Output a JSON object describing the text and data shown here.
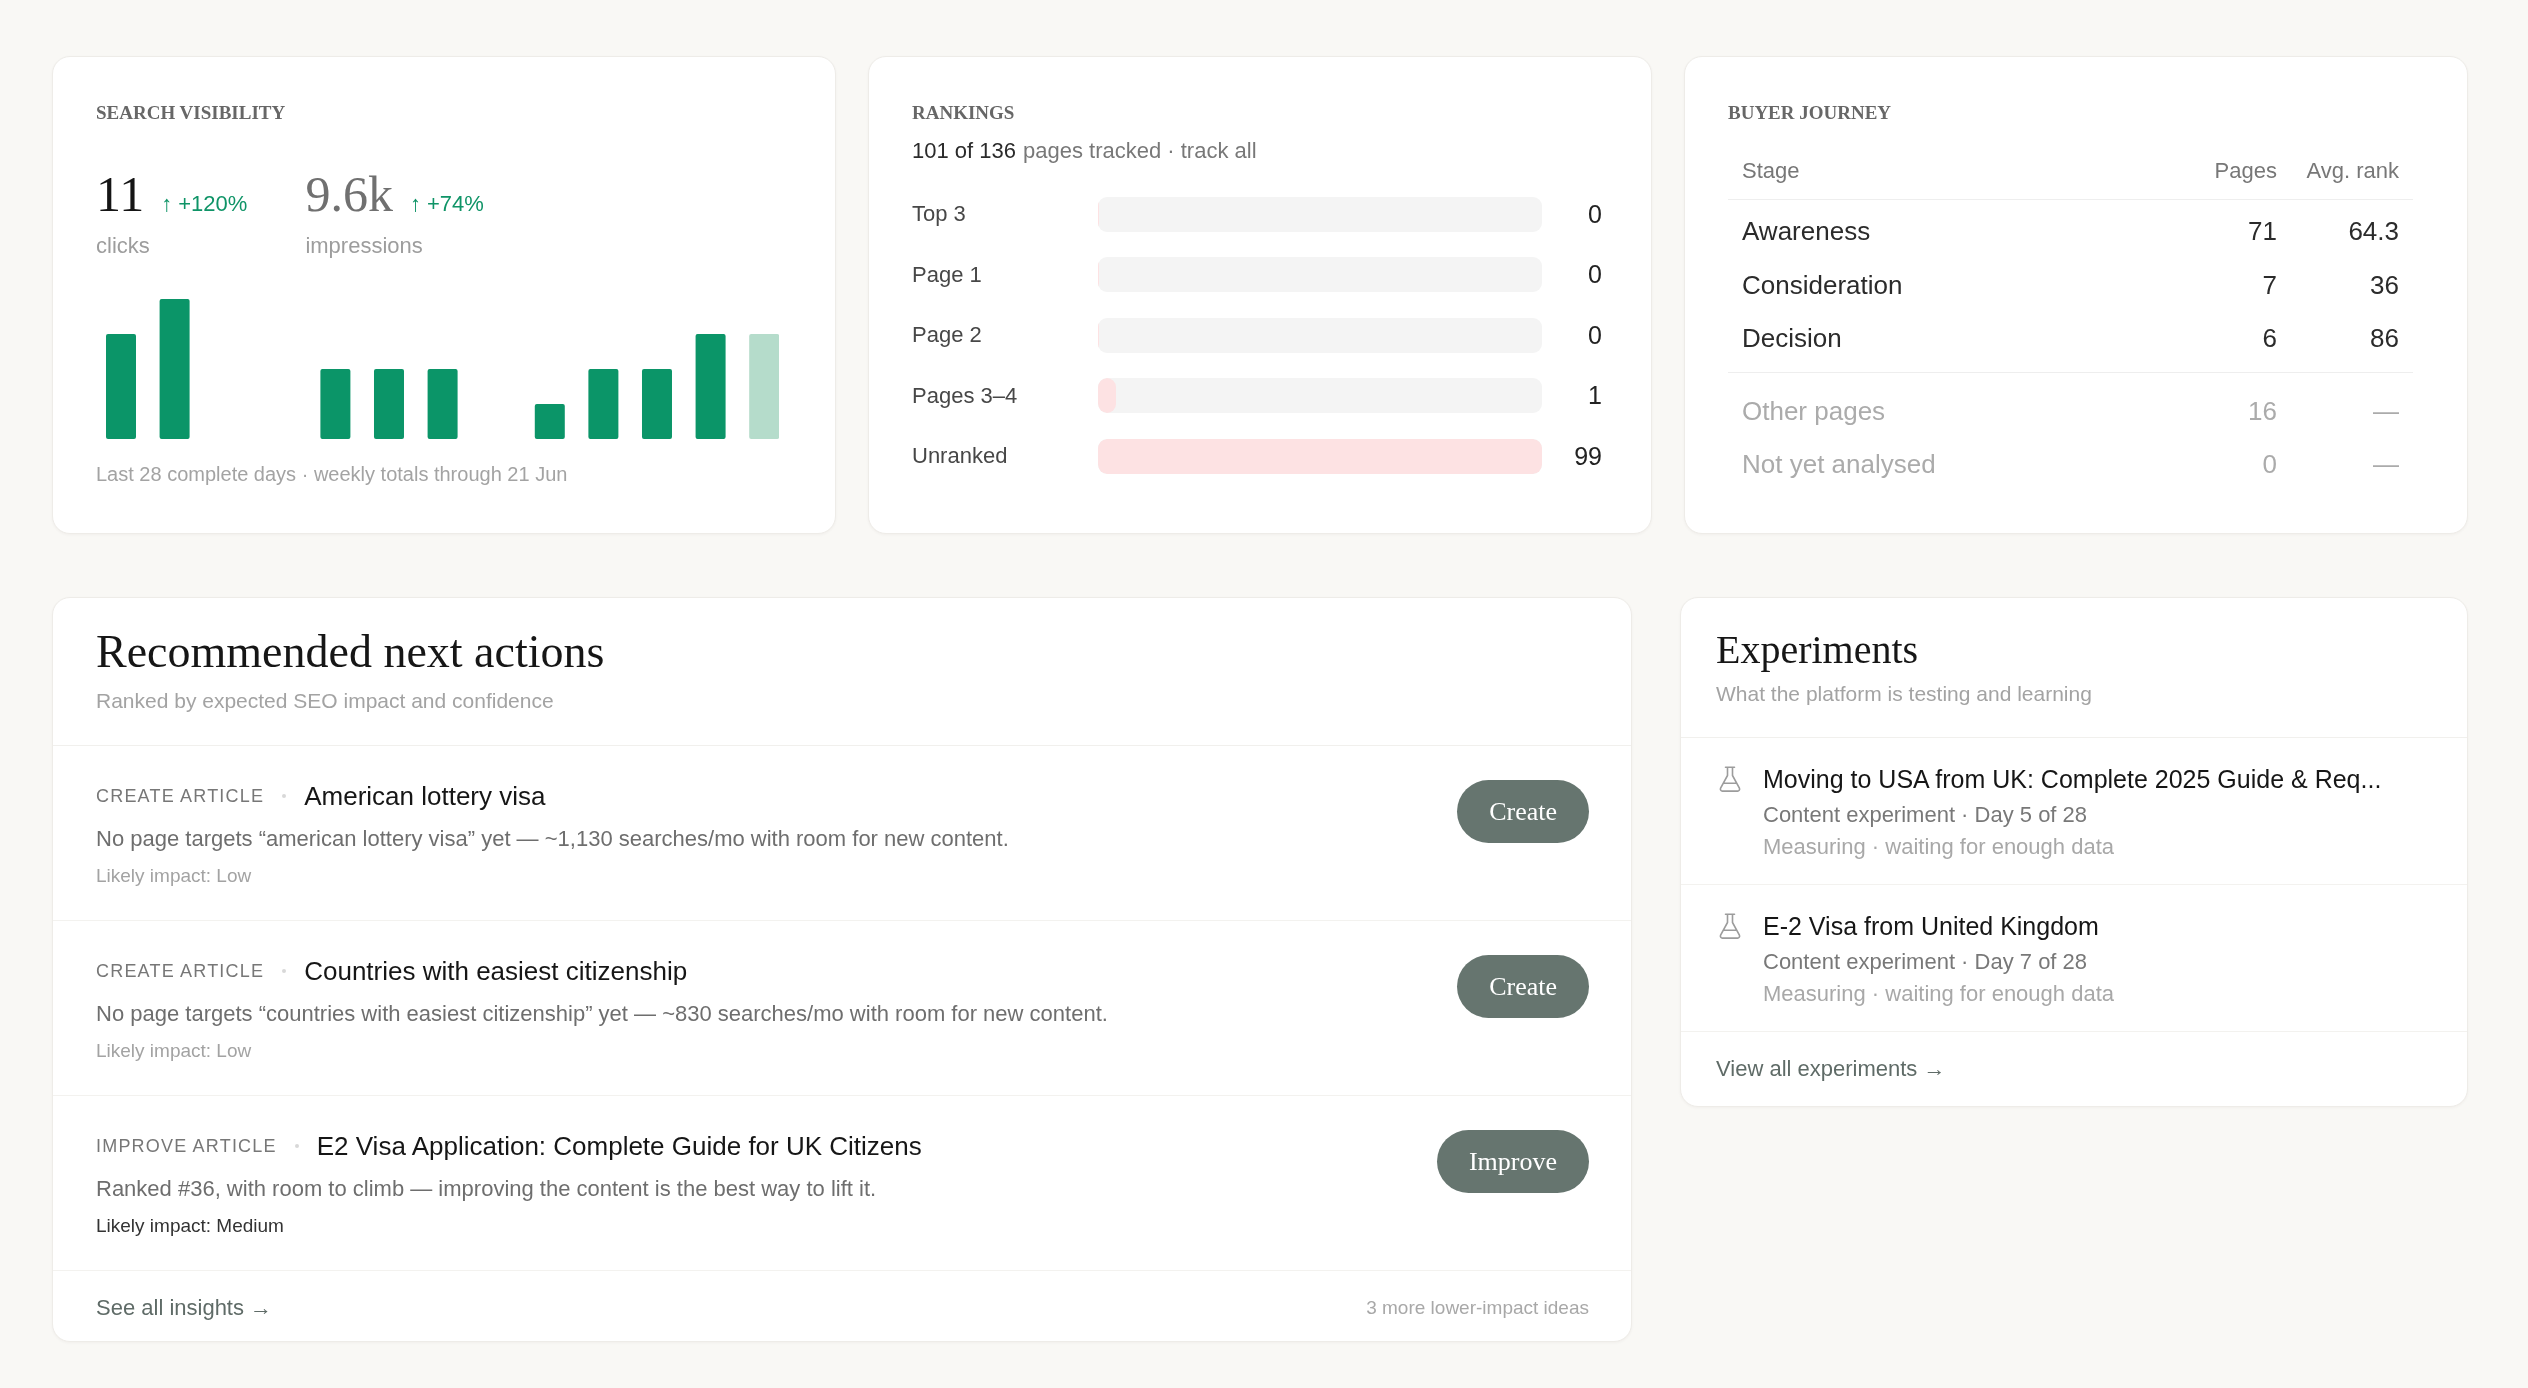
{
  "search_visibility": {
    "title": "SEARCH VISIBILITY",
    "metrics": [
      {
        "value": "11",
        "change": "↑ +120%",
        "positive": true,
        "label": "clicks"
      },
      {
        "value": "9.6k",
        "change": "↑ +74%",
        "positive": true,
        "label": "impressions"
      }
    ],
    "caption": "Last 28 complete days · weekly totals through 21 Jun"
  },
  "rankings": {
    "title": "RANKINGS",
    "tracked_count": "101 of 136",
    "tracked_text": "pages tracked · track all",
    "rows": [
      {
        "label": "Top 3",
        "level": 0,
        "count": "0"
      },
      {
        "label": "Page 1",
        "level": 0,
        "count": "0"
      },
      {
        "label": "Page 2",
        "level": 0,
        "count": "0"
      },
      {
        "label": "Pages 3–4",
        "level": 0.04,
        "count": "1"
      },
      {
        "label": "Unranked",
        "level": 1,
        "count": "99"
      }
    ]
  },
  "buyer_journey": {
    "title": "BUYER JOURNEY",
    "columns": [
      "Stage",
      "Pages",
      "Avg. rank"
    ],
    "rows": [
      {
        "stage": "Awareness",
        "pages": "71",
        "avg_rank": "64.3",
        "muted": false
      },
      {
        "stage": "Consideration",
        "pages": "7",
        "avg_rank": "36",
        "muted": false
      },
      {
        "stage": "Decision",
        "pages": "6",
        "avg_rank": "86",
        "muted": false
      },
      {
        "stage": "Other pages",
        "pages": "16",
        "avg_rank": "—",
        "muted": true
      },
      {
        "stage": "Not yet analysed",
        "pages": "0",
        "avg_rank": "—",
        "muted": true
      }
    ]
  },
  "recommended_actions": {
    "title": "Recommended next actions",
    "subtitle": "Ranked by expected SEO impact and confidence",
    "items": [
      {
        "type_label": "CREATE ARTICLE",
        "title": "American lottery visa",
        "description": "No page targets “american lottery visa” yet — ~1,130 searches/mo with room for new content.",
        "impact": "Likely impact: Low",
        "impact_emphasized": false,
        "button": "Create"
      },
      {
        "type_label": "CREATE ARTICLE",
        "title": "Countries with easiest citizenship",
        "description": "No page targets “countries with easiest citizenship” yet — ~830 searches/mo with room for new content.",
        "impact": "Likely impact: Low",
        "impact_emphasized": false,
        "button": "Create"
      },
      {
        "type_label": "IMPROVE ARTICLE",
        "title": "E2 Visa Application: Complete Guide for UK Citizens",
        "description": "Ranked #36, with room to climb — improving the content is the best way to lift it.",
        "impact": "Likely impact: Medium",
        "impact_emphasized": true,
        "button": "Improve"
      }
    ],
    "footer_link": "See all insights →",
    "footer_note": "3 more lower-impact ideas"
  },
  "experiments": {
    "title": "Experiments",
    "subtitle": "What the platform is testing and learning",
    "items": [
      {
        "title": "Moving to USA from UK: Complete 2025 Guide & Req...",
        "meta": "Content experiment · Day 5 of 28",
        "status": "Measuring · waiting for enough data"
      },
      {
        "title": "E-2 Visa from United Kingdom",
        "meta": "Content experiment · Day 7 of 28",
        "status": "Measuring · waiting for enough data"
      }
    ],
    "footer_link": "View all experiments →"
  }
}
